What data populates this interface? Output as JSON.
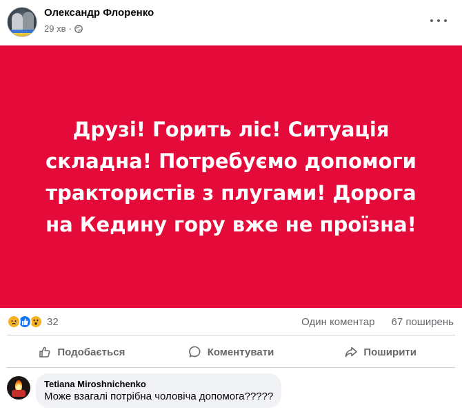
{
  "post": {
    "author": "Олександр Флоренко",
    "time": "29 хв",
    "separator": "·",
    "privacy_icon": "globe-icon",
    "menu_icon": "more-options-icon",
    "image_text": "Друзі! Горить ліс! Ситуація складна! Потребуємо допомоги трактористів з плугами! Дорога на Кедину гору вже не проїзна!",
    "image_background": "#e40b3a"
  },
  "stats": {
    "reaction_icons": [
      "sad-reaction-icon",
      "like-reaction-icon",
      "wow-reaction-icon"
    ],
    "reaction_count": "32",
    "comments": "Один коментар",
    "shares": "67 поширень"
  },
  "actions": {
    "like": "Подобається",
    "comment": "Коментувати",
    "share": "Поширити"
  },
  "comment": {
    "author": "Tetiana Miroshnichenko",
    "text": "Може взагалі потрібна чоловіча допомога?????"
  }
}
